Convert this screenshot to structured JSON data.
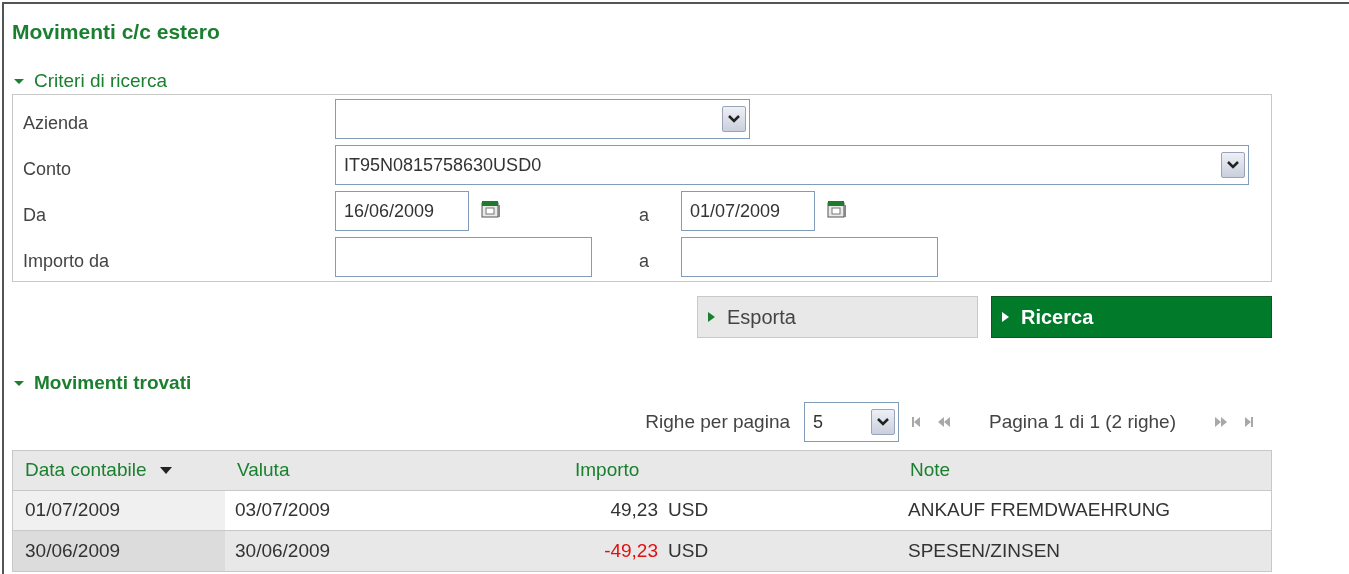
{
  "page": {
    "title": "Movimenti c/c estero"
  },
  "search": {
    "header": "Criteri di ricerca",
    "expanded": true,
    "azienda": {
      "label": "Azienda"
    },
    "conto": {
      "label": "Conto",
      "value": "IT95N0815758630USD0"
    },
    "date": {
      "label": "Da",
      "from": "16/06/2009",
      "to_label": "a",
      "to": "01/07/2009"
    },
    "amount": {
      "label": "Importo da",
      "to_label": "a"
    },
    "buttons": [
      {
        "label": "Esporta",
        "primary": false
      },
      {
        "label": "Ricerca",
        "primary": true
      }
    ]
  },
  "results": {
    "header": "Movimenti trovati",
    "expanded": true,
    "pager": {
      "rows_label": "Righe per pagina",
      "rows_value": "5",
      "status": "Pagina 1 di 1 (2 righe)",
      "nav": [
        {
          "kind": "first",
          "disabled": true
        },
        {
          "kind": "prev",
          "disabled": true
        },
        {
          "kind": "next",
          "disabled": true
        },
        {
          "kind": "last",
          "disabled": true
        }
      ]
    },
    "table": {
      "columns": [
        {
          "label": "Data contabile",
          "sorted": true
        },
        {
          "label": "Valuta",
          "sorted": false
        },
        {
          "label": "Importo",
          "sorted": false
        },
        {
          "label": "Note",
          "sorted": false
        }
      ],
      "rows": [
        {
          "data_contabile": "01/07/2009",
          "valuta": "03/07/2009",
          "importo": "49,23",
          "negative": false,
          "currency": "USD",
          "note": "ANKAUF FREMDWAEHRUNG"
        },
        {
          "data_contabile": "30/06/2009",
          "valuta": "30/06/2009",
          "importo": "-49,23",
          "negative": true,
          "currency": "USD",
          "note": "SPESEN/ZINSEN"
        }
      ]
    }
  }
}
